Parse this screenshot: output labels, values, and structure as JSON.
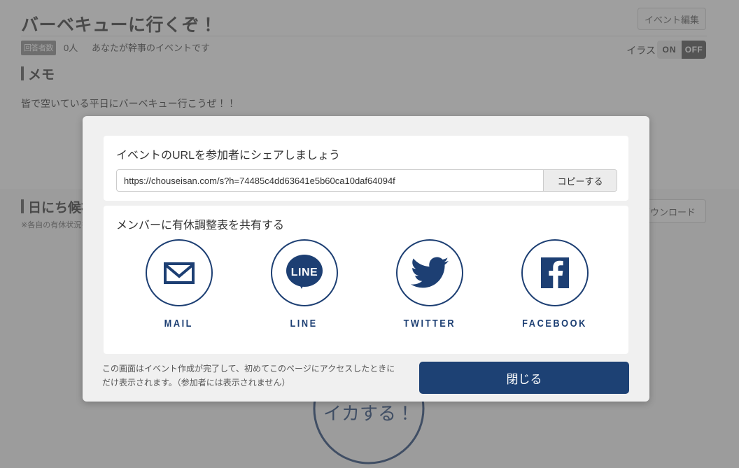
{
  "background": {
    "event_title": "バーベキューに行くぞ！",
    "edit_event_label": "イベント編集",
    "responses_badge": "回答者数",
    "responses_count": "0人",
    "organizer_note": "あなたが幹事のイベントです",
    "illustration_label": "イラスト",
    "toggle_on_label": "ON",
    "toggle_off_label": "OFF",
    "memo_heading": "メモ",
    "memo_body": "皆で空いている平日にバーベキュー行こうぜ！！",
    "dates_heading": "日にち候補",
    "dates_note": "※各自の有休状況をご記入ください",
    "download_label": "ダウンロード",
    "stamp_text": "イカする！"
  },
  "modal": {
    "url_section": {
      "title": "イベントのURLを参加者にシェアしましょう",
      "url_value": "https://chouseisan.com/s?h=74485c4dd63641e5b60ca10daf64094f",
      "url_placeholder": "https://chouseisan.com/s?h=",
      "copy_label": "コピーする"
    },
    "share_section": {
      "title": "メンバーに有休調整表を共有する",
      "items": [
        {
          "label": "MAIL",
          "icon": "mail-icon"
        },
        {
          "label": "LINE",
          "icon": "line-icon"
        },
        {
          "label": "TWITTER",
          "icon": "twitter-icon"
        },
        {
          "label": "FACEBOOK",
          "icon": "facebook-icon"
        }
      ]
    },
    "footnote": "この画面はイベント作成が完了して、初めてこのページにアクセスしたときにだけ表示されます。（参加者には表示されません）",
    "close_label": "閉じる"
  },
  "colors": {
    "brand_navy": "#1d3f73",
    "close_button": "#1d4174",
    "modal_bg": "#f0f0f0",
    "overlay": "rgba(90,90,90,0.58)",
    "badge_gray": "#8b8b8b"
  }
}
